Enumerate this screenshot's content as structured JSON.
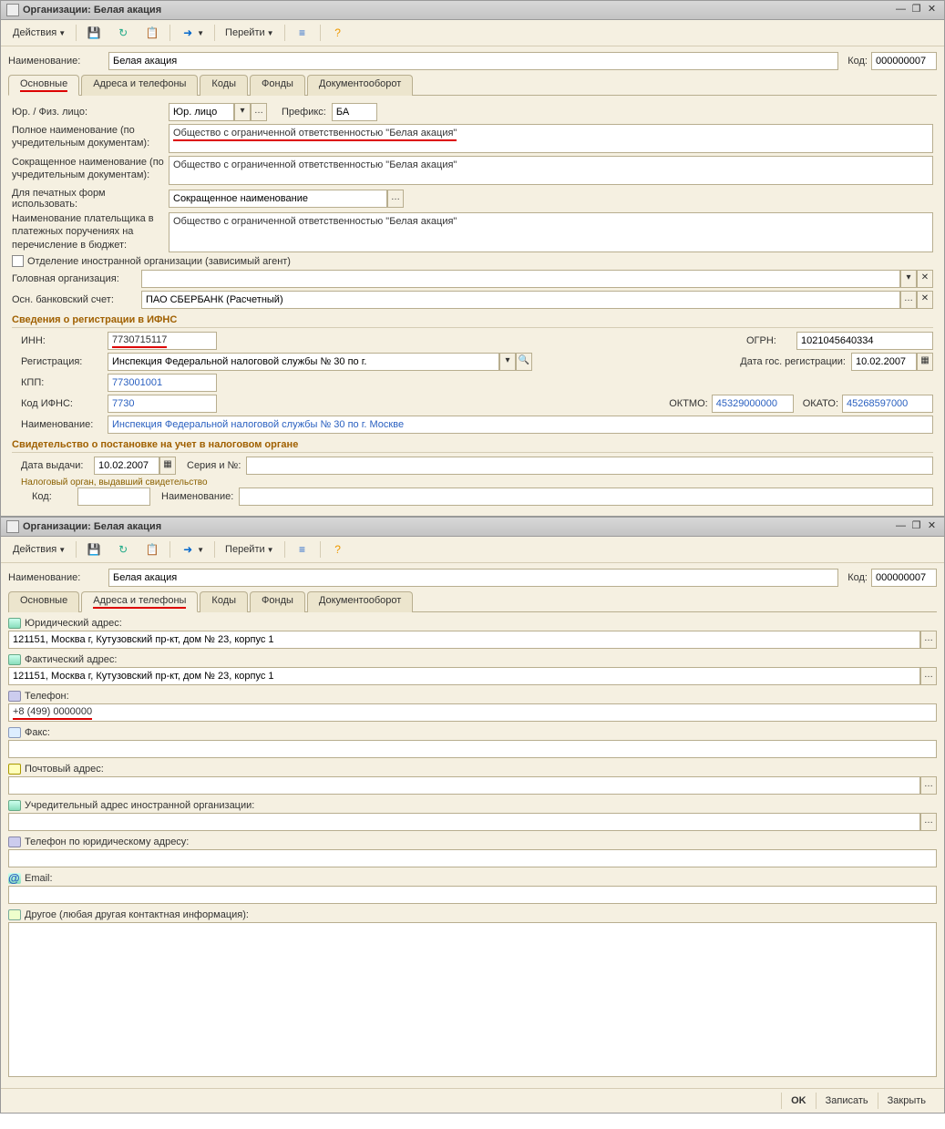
{
  "window1": {
    "title": "Организации: Белая акация",
    "toolbar": {
      "actions": "Действия",
      "goto": "Перейти"
    },
    "name_label": "Наименование:",
    "name_value": "Белая акация",
    "code_label": "Код:",
    "code_value": "000000007",
    "tabs": [
      "Основные",
      "Адреса и телефоны",
      "Коды",
      "Фонды",
      "Документооборот"
    ],
    "main": {
      "legal_type_label": "Юр. / Физ. лицо:",
      "legal_type_value": "Юр. лицо",
      "prefix_label": "Префикс:",
      "prefix_value": "БА",
      "full_name_label": "Полное наименование (по учредительным документам):",
      "full_name_value": "Общество с ограниченной ответственностью \"Белая акация\"",
      "short_name_label": "Сокращенное наименование (по учредительным документам):",
      "short_name_value": "Общество с ограниченной ответственностью \"Белая акация\"",
      "print_forms_label": "Для печатных форм использовать:",
      "print_forms_value": "Сокращенное наименование",
      "payer_name_label": "Наименование плательщика в платежных поручениях на перечисление в бюджет:",
      "payer_name_value": "Общество с ограниченной ответственностью \"Белая акация\"",
      "foreign_branch_label": "Отделение иностранной организации (зависимый агент)",
      "head_org_label": "Головная организация:",
      "head_org_value": "",
      "bank_label": "Осн. банковский счет:",
      "bank_value": "ПАО СБЕРБАНК (Расчетный)",
      "ifns_section": "Сведения о регистрации в ИФНС",
      "inn_label": "ИНН:",
      "inn_value": "7730715117",
      "ogrn_label": "ОГРН:",
      "ogrn_value": "1021045640334",
      "reg_label": "Регистрация:",
      "reg_value": "Инспекция Федеральной налоговой службы № 30 по г.",
      "reg_date_label": "Дата гос. регистрации:",
      "reg_date_value": "10.02.2007",
      "kpp_label": "КПП:",
      "kpp_value": "773001001",
      "ifns_code_label": "Код ИФНС:",
      "ifns_code_value": "7730",
      "oktmo_label": "ОКТМО:",
      "oktmo_value": "45329000000",
      "okato_label": "ОКАТО:",
      "okato_value": "45268597000",
      "ifns_name_label": "Наименование:",
      "ifns_name_value": "Инспекция Федеральной налоговой службы № 30 по г. Москве",
      "cert_section": "Свидетельство о постановке на учет в налоговом органе",
      "cert_date_label": "Дата выдачи:",
      "cert_date_value": "10.02.2007",
      "cert_serial_label": "Серия и №:",
      "cert_serial_value": "",
      "cert_authority": "Налоговый орган, выдавший свидетельство",
      "cert_code_label": "Код:",
      "cert_code_value": "",
      "cert_name_label": "Наименование:",
      "cert_name_value": ""
    }
  },
  "window2": {
    "title": "Организации: Белая акация",
    "addr": {
      "legal_label": "Юридический адрес:",
      "legal_value": "121151, Москва г, Кутузовский пр-кт, дом № 23, корпус 1",
      "actual_label": "Фактический адрес:",
      "actual_value": "121151, Москва г, Кутузовский пр-кт, дом № 23, корпус 1",
      "phone_label": "Телефон:",
      "phone_value": "+8 (499) 0000000",
      "fax_label": "Факс:",
      "fax_value": "",
      "postal_label": "Почтовый адрес:",
      "postal_value": "",
      "foreign_label": "Учредительный адрес иностранной организации:",
      "foreign_value": "",
      "legal_phone_label": "Телефон по юридическому адресу:",
      "legal_phone_value": "",
      "email_label": "Email:",
      "email_value": "",
      "other_label": "Другое (любая другая контактная информация):",
      "other_value": ""
    },
    "footer": {
      "ok": "OK",
      "save": "Записать",
      "close": "Закрыть"
    }
  }
}
